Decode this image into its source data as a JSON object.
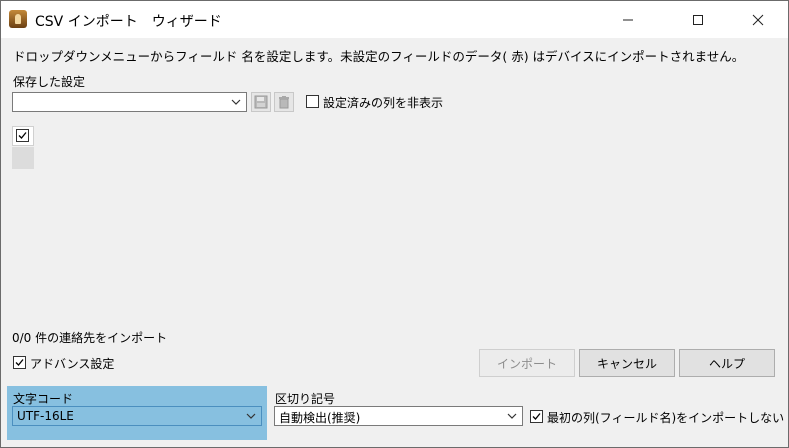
{
  "window": {
    "title": "CSV インポート　ウィザード",
    "controls": {
      "minimize": "—",
      "maximize": "☐",
      "close": "✕"
    }
  },
  "instruction": "ドロップダウンメニューからフィールド 名を設定します。未設定のフィールドのデータ( 赤) はデバイスにインポートされません。",
  "saved_settings": {
    "label": "保存した設定",
    "value": "",
    "hide_set_columns_label": "設定済みの列を非表示",
    "hide_set_columns_checked": false
  },
  "grid": {
    "header_checkbox_checked": true
  },
  "status": {
    "import_count": "0/0 件の連絡先をインポート"
  },
  "advanced": {
    "label": "アドバンス設定",
    "checked": true
  },
  "buttons": {
    "import": "インポート",
    "cancel": "キャンセル",
    "help": "ヘルプ"
  },
  "encoding": {
    "label": "文字コード",
    "value": "UTF-16LE"
  },
  "delimiter": {
    "label": "区切り記号",
    "value": "自動検出(推奨)"
  },
  "first_row": {
    "label": "最初の列(フィールド名)をインポートしない",
    "checked": true
  },
  "colors": {
    "selection_panel": "#87c0e0",
    "window_bg": "#f0f0f0"
  }
}
